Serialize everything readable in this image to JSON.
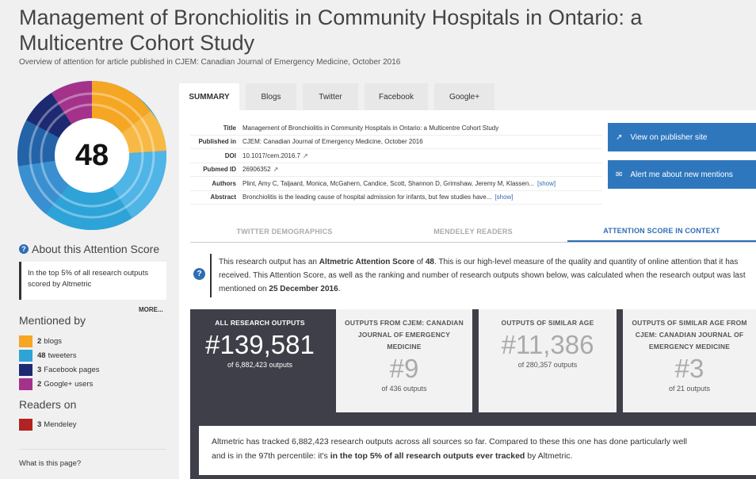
{
  "title": "Management of Bronchiolitis in Community Hospitals in Ontario: a Multicentre Cohort Study",
  "subtitle": "Overview of attention for article published in CJEM: Canadian Journal of Emergency Medicine, October 2016",
  "score": "48",
  "colors": {
    "blogs": "#f5a623",
    "tweeters": "#2ea3d8",
    "facebook": "#1d2a72",
    "google": "#a4328b",
    "mendeley": "#b22222",
    "accent": "#2f77bd"
  },
  "sidebar": {
    "about_title": "About this Attention Score",
    "top5_text": "In the top 5% of all research outputs scored by Altmetric",
    "more_label": "MORE...",
    "mentioned_title": "Mentioned by",
    "mentions": [
      {
        "count": "2",
        "label": "blogs"
      },
      {
        "count": "48",
        "label": "tweeters"
      },
      {
        "count": "3",
        "label": "Facebook pages"
      },
      {
        "count": "2",
        "label": "Google+ users"
      }
    ],
    "readers_title": "Readers on",
    "readers": [
      {
        "count": "3",
        "label": "Mendeley"
      }
    ],
    "what_page": "What is this page?"
  },
  "tabs": [
    "SUMMARY",
    "Blogs",
    "Twitter",
    "Facebook",
    "Google+"
  ],
  "details": {
    "title_label": "Title",
    "title_value": "Management of Bronchiolitis in Community Hospitals in Ontario: a Multicentre Cohort Study",
    "published_label": "Published in",
    "published_value": "CJEM: Canadian Journal of Emergency Medicine, October 2016",
    "doi_label": "DOI",
    "doi_value": "10.1017/cem.2016.7",
    "pubmed_label": "Pubmed ID",
    "pubmed_value": "26906352",
    "authors_label": "Authors",
    "authors_value": "Plint, Amy C, Taljaard, Monica, McGahern, Candice, Scott, Shannon D, Grimshaw, Jeremy M, Klassen...",
    "abstract_label": "Abstract",
    "abstract_value": "Bronchiolitis is the leading cause of hospital admission for infants, but few studies have...",
    "show_label": "[show]"
  },
  "buttons": {
    "publisher": "View on publisher site",
    "alert": "Alert me about new mentions"
  },
  "subtabs": [
    "TWITTER DEMOGRAPHICS",
    "MENDELEY READERS",
    "ATTENTION SCORE IN CONTEXT"
  ],
  "context": {
    "line1_a": "This research output has an ",
    "line1_b": "Altmetric Attention Score",
    "line1_c": " of ",
    "line1_d": "48",
    "line1_e": ". This is our high-level measure of the quality and quantity of online attention that it has",
    "line2": "received. This Attention Score, as well as the ranking and number of research outputs shown below, was calculated when the research output was last",
    "line3_a": "mentioned on ",
    "line3_b": "25 December 2016",
    "line3_c": "."
  },
  "stats": [
    {
      "head": "ALL RESEARCH OUTPUTS",
      "rank": "#139,581",
      "of": "of 6,882,423 outputs"
    },
    {
      "head": "OUTPUTS FROM CJEM: CANADIAN JOURNAL OF EMERGENCY MEDICINE",
      "rank": "#9",
      "of": "of 436 outputs"
    },
    {
      "head": "OUTPUTS OF SIMILAR AGE",
      "rank": "#11,386",
      "of": "of 280,357 outputs"
    },
    {
      "head": "OUTPUTS OF SIMILAR AGE FROM CJEM: CANADIAN JOURNAL OF EMERGENCY MEDICINE",
      "rank": "#3",
      "of": "of 21 outputs"
    }
  ],
  "summary": {
    "line1": "Altmetric has tracked 6,882,423 research outputs across all sources so far. Compared to these this one has done particularly well",
    "line2_a": "and is in the 97th percentile: it's ",
    "line2_b": "in the top 5% of all research outputs ever tracked",
    "line2_c": " by Altmetric."
  }
}
